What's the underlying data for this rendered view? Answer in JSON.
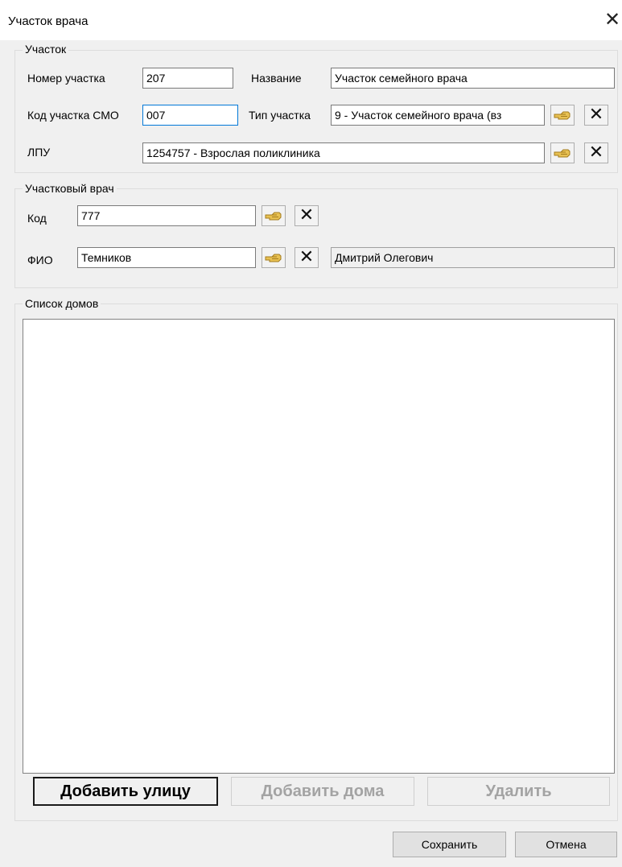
{
  "window": {
    "title": "Участок врача"
  },
  "section_district": {
    "legend": "Участок",
    "number_label": "Номер участка",
    "number_value": "207",
    "name_label": "Название",
    "name_value": "Участок семейного врача",
    "smo_label": "Код участка СМО",
    "smo_value": "007",
    "type_label": "Тип участка",
    "type_value": "9 - Участок семейного врача (вз",
    "lpu_label": "ЛПУ",
    "lpu_value": "1254757 - Взрослая поликлиника"
  },
  "section_doctor": {
    "legend": "Участковый врач",
    "code_label": "Код",
    "code_value": "777",
    "fio_label": "ФИО",
    "surname_value": "Темников",
    "given_names_value": "Дмитрий Олегович"
  },
  "section_houses": {
    "legend": "Список домов",
    "add_street_label": "Добавить улицу",
    "add_houses_label": "Добавить дома",
    "delete_label": "Удалить"
  },
  "footer": {
    "save_label": "Сохранить",
    "cancel_label": "Отмена"
  },
  "icons": {
    "lookup": "lookup-hand-icon",
    "clear": "close-x-icon",
    "window_close": "window-close-icon"
  }
}
